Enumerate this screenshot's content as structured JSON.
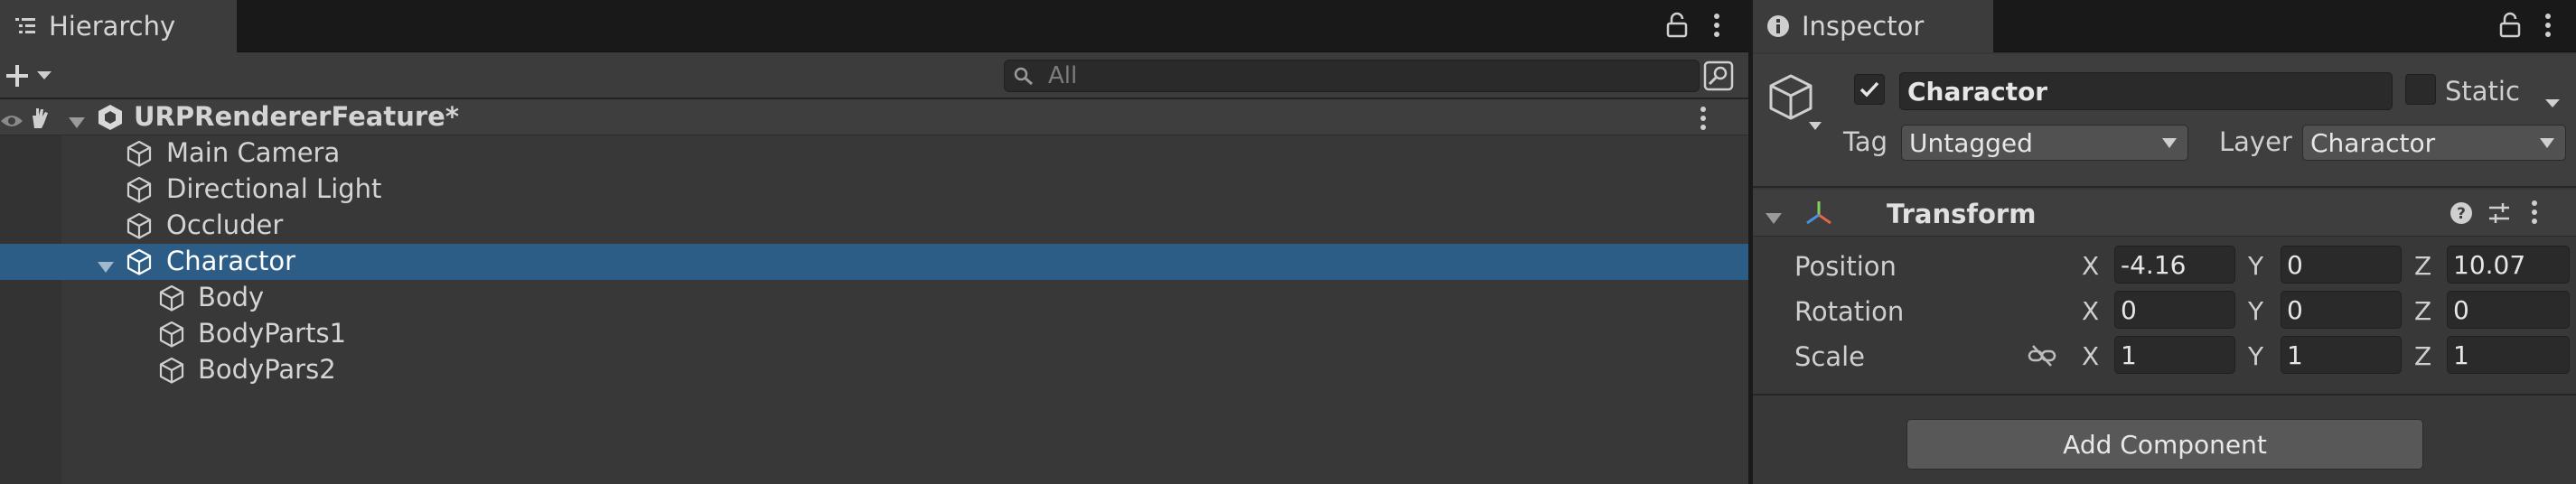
{
  "hierarchy": {
    "tab_label": "Hierarchy",
    "search_placeholder": "All",
    "scene_name": "URPRendererFeature*",
    "items": [
      {
        "label": "Main Camera"
      },
      {
        "label": "Directional Light"
      },
      {
        "label": "Occluder"
      },
      {
        "label": "Charactor"
      },
      {
        "label": "Body"
      },
      {
        "label": "BodyParts1"
      },
      {
        "label": "BodyPars2"
      }
    ]
  },
  "inspector": {
    "tab_label": "Inspector",
    "object_name": "Charactor",
    "active": true,
    "static_label": "Static",
    "static_checked": false,
    "tag_label": "Tag",
    "tag_value": "Untagged",
    "layer_label": "Layer",
    "layer_value": "Charactor",
    "component": {
      "name": "Transform",
      "position": {
        "label": "Position",
        "x": "-4.16",
        "y": "0",
        "z": "10.07"
      },
      "rotation": {
        "label": "Rotation",
        "x": "0",
        "y": "0",
        "z": "0"
      },
      "scale": {
        "label": "Scale",
        "x": "1",
        "y": "1",
        "z": "1"
      },
      "axis_labels": {
        "x": "X",
        "y": "Y",
        "z": "Z"
      }
    },
    "add_component_label": "Add Component"
  },
  "colors": {
    "selection": "#2c5d87",
    "panel_bg": "#383838",
    "tabbar_bg": "#191919"
  }
}
